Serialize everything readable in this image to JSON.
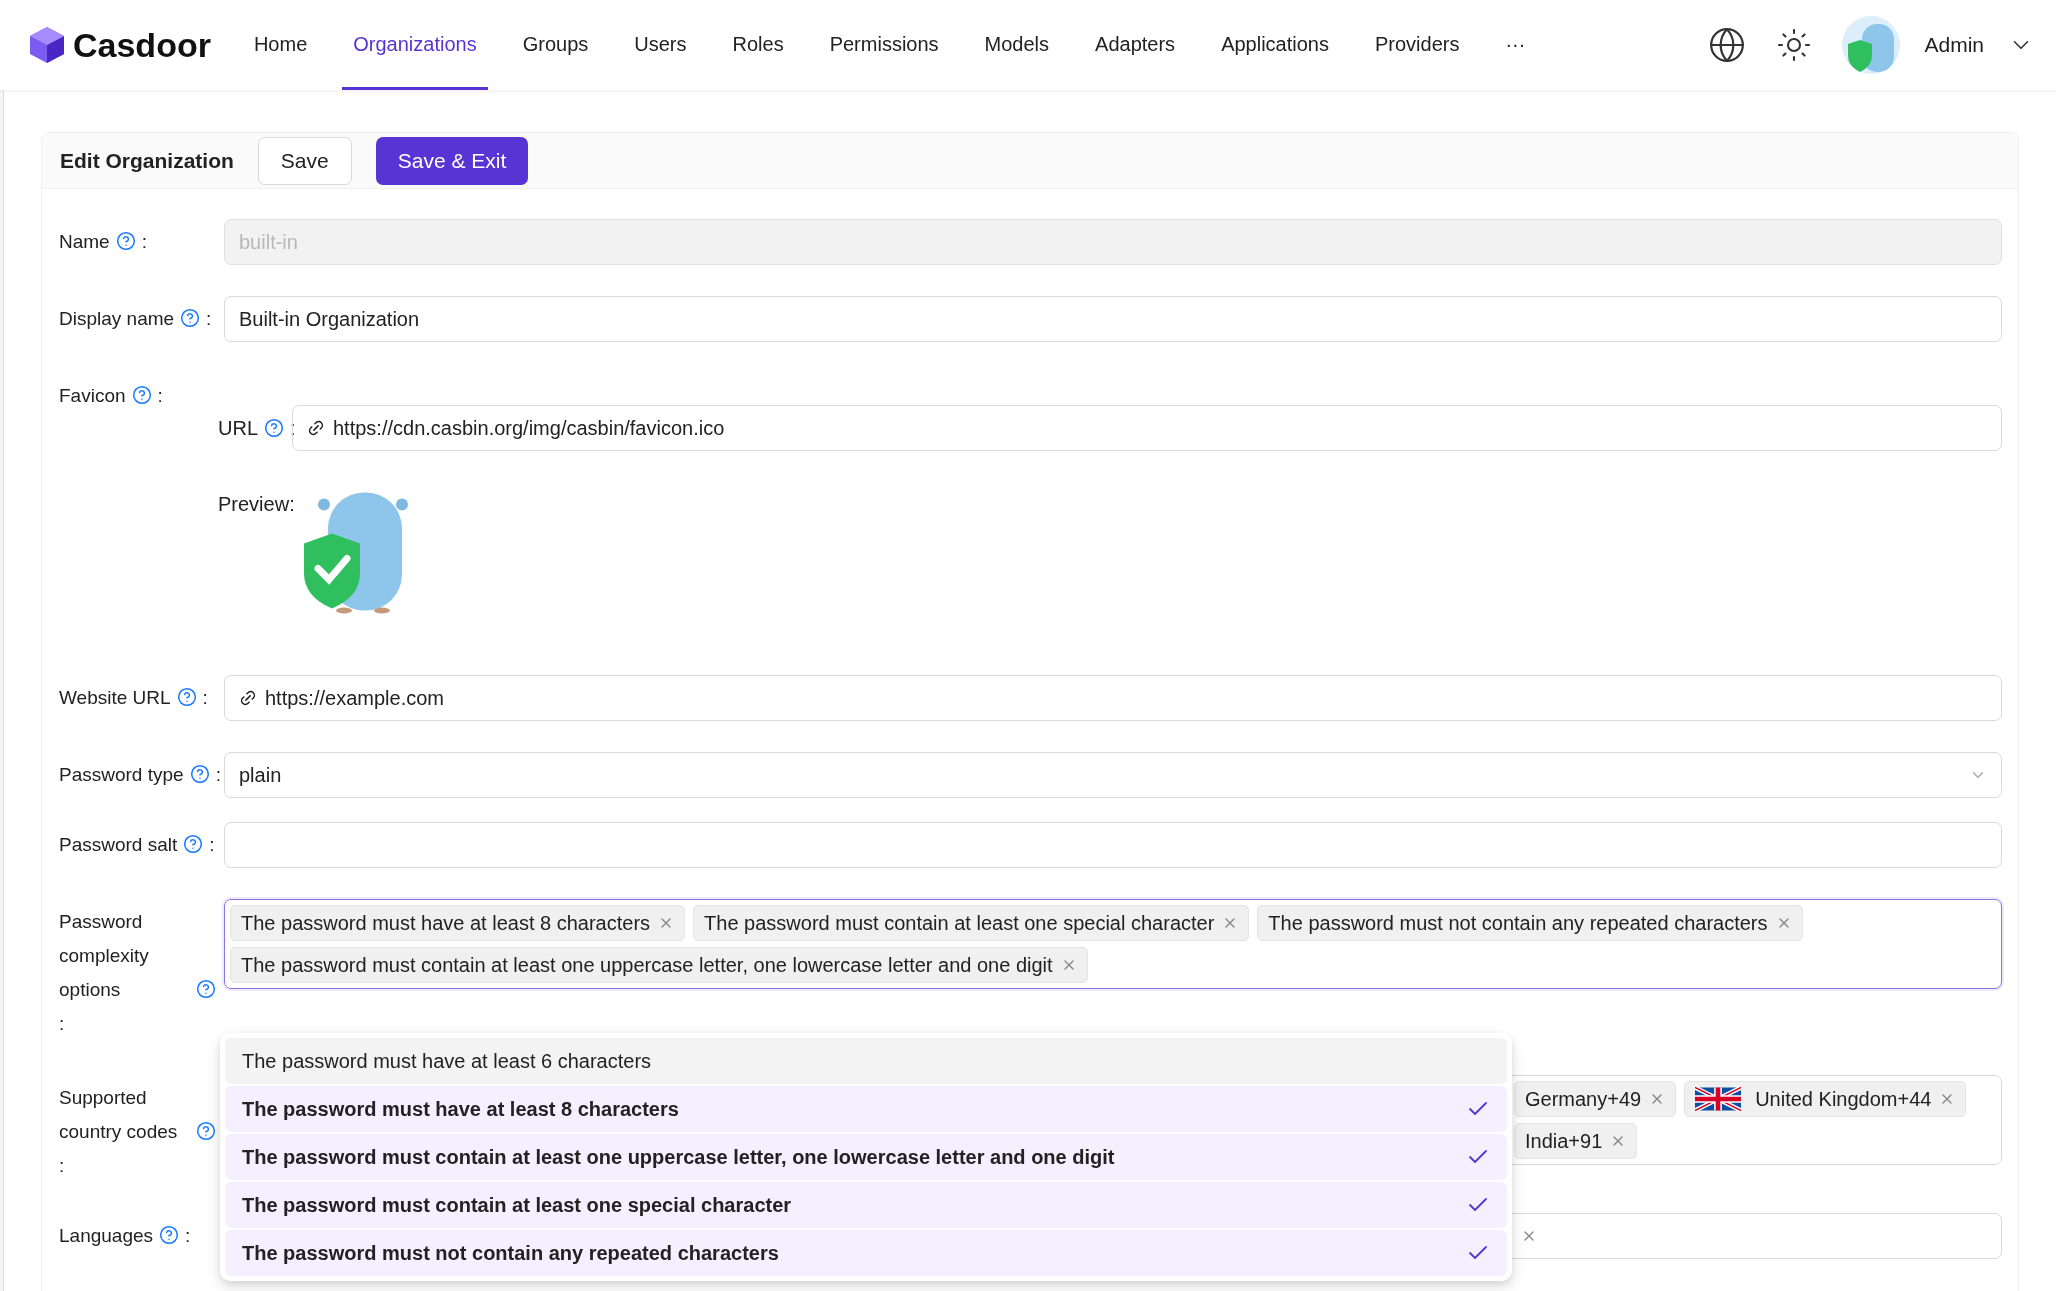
{
  "brand": "Casdoor",
  "nav": [
    {
      "label": "Home",
      "selected": false
    },
    {
      "label": "Organizations",
      "selected": true
    },
    {
      "label": "Groups",
      "selected": false
    },
    {
      "label": "Users",
      "selected": false
    },
    {
      "label": "Roles",
      "selected": false
    },
    {
      "label": "Permissions",
      "selected": false
    },
    {
      "label": "Models",
      "selected": false
    },
    {
      "label": "Adapters",
      "selected": false
    },
    {
      "label": "Applications",
      "selected": false
    },
    {
      "label": "Providers",
      "selected": false
    },
    {
      "label": "···",
      "selected": false
    }
  ],
  "user": {
    "name": "Admin"
  },
  "form": {
    "title": "Edit Organization",
    "buttons": [
      {
        "label": "Save",
        "kind": "default"
      },
      {
        "label": "Save & Exit",
        "kind": "primary"
      }
    ],
    "fields": [
      {
        "kind": "text",
        "label": "Name",
        "colon": ":",
        "value": "built-in",
        "disabled": true
      },
      {
        "kind": "text",
        "label": "Display name",
        "colon": ":",
        "value": "Built-in Organization",
        "disabled": false
      },
      {
        "kind": "favicon",
        "label": "Favicon",
        "colon": ":",
        "url_label": "URL",
        "url_colon": ":",
        "url": "https://cdn.casbin.org/img/casbin/favicon.ico",
        "preview_label": "Preview:"
      },
      {
        "kind": "link",
        "label": "Website URL",
        "colon": ":",
        "value": "https://example.com"
      },
      {
        "kind": "select",
        "label": "Password type",
        "colon": ":",
        "value": "plain"
      },
      {
        "kind": "text",
        "label": "Password salt",
        "colon": ":",
        "disabled": false
      },
      {
        "kind": "tags",
        "label": "Password complexity options",
        "colon": ":",
        "focused": true,
        "tags": [
          {
            "label": "The password must have at least 8 characters"
          },
          {
            "label": "The password must contain at least one special character"
          },
          {
            "label": "The password must not contain any repeated characters"
          },
          {
            "label": "The password must contain at least one uppercase letter, one lowercase letter and one digit"
          }
        ]
      },
      {
        "kind": "countries",
        "label": "Supported country codes",
        "colon": ":",
        "rows": [
          [
            {
              "label": "Germany+49",
              "flag_shown": false
            },
            {
              "label": "United Kingdom+44",
              "flag_shown": true
            }
          ],
          [
            {
              "label": "India+91",
              "flag_shown": false
            }
          ]
        ]
      },
      {
        "kind": "hidden_tags",
        "label": "Languages",
        "colon": ":"
      }
    ]
  },
  "dropdown": {
    "options": [
      {
        "label": "The password must have at least 6 characters",
        "selected": false,
        "highlighted": true
      },
      {
        "label": "The password must have at least 8 characters",
        "selected": true,
        "highlighted": false
      },
      {
        "label": "The password must contain at least one uppercase letter, one lowercase letter and one digit",
        "selected": true,
        "highlighted": false
      },
      {
        "label": "The password must contain at least one special character",
        "selected": true,
        "highlighted": false
      },
      {
        "label": "The password must not contain any repeated characters",
        "selected": true,
        "highlighted": false
      }
    ]
  }
}
